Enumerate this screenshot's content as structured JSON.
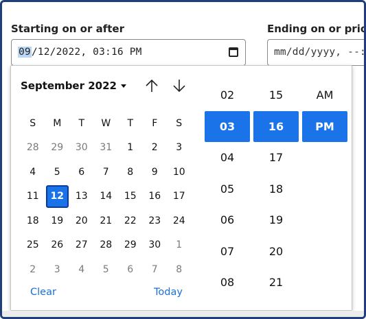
{
  "fields": {
    "start": {
      "label": "Starting on or after",
      "value_month": "09",
      "value_rest": "/12/2022, 03:16 PM"
    },
    "end": {
      "label": "Ending on or prio",
      "placeholder": "mm/dd/yyyy, --:"
    }
  },
  "calendar": {
    "month_label": "September 2022",
    "weekdays": [
      "S",
      "M",
      "T",
      "W",
      "T",
      "F",
      "S"
    ],
    "weeks": [
      [
        {
          "d": "28",
          "dim": true
        },
        {
          "d": "29",
          "dim": true
        },
        {
          "d": "30",
          "dim": true
        },
        {
          "d": "31",
          "dim": true
        },
        {
          "d": "1"
        },
        {
          "d": "2"
        },
        {
          "d": "3"
        }
      ],
      [
        {
          "d": "4"
        },
        {
          "d": "5"
        },
        {
          "d": "6"
        },
        {
          "d": "7"
        },
        {
          "d": "8"
        },
        {
          "d": "9"
        },
        {
          "d": "10"
        }
      ],
      [
        {
          "d": "11"
        },
        {
          "d": "12",
          "selected": true
        },
        {
          "d": "13"
        },
        {
          "d": "14"
        },
        {
          "d": "15"
        },
        {
          "d": "16"
        },
        {
          "d": "17"
        }
      ],
      [
        {
          "d": "18"
        },
        {
          "d": "19"
        },
        {
          "d": "20"
        },
        {
          "d": "21"
        },
        {
          "d": "22"
        },
        {
          "d": "23"
        },
        {
          "d": "24"
        }
      ],
      [
        {
          "d": "25"
        },
        {
          "d": "26"
        },
        {
          "d": "27"
        },
        {
          "d": "28"
        },
        {
          "d": "29"
        },
        {
          "d": "30"
        },
        {
          "d": "1",
          "dim": true
        }
      ],
      [
        {
          "d": "2",
          "dim": true
        },
        {
          "d": "3",
          "dim": true
        },
        {
          "d": "4",
          "dim": true
        },
        {
          "d": "5",
          "dim": true
        },
        {
          "d": "6",
          "dim": true
        },
        {
          "d": "7",
          "dim": true
        },
        {
          "d": "8",
          "dim": true
        }
      ]
    ],
    "clear_label": "Clear",
    "today_label": "Today"
  },
  "time": {
    "hours": [
      "02",
      "03",
      "04",
      "05",
      "06",
      "07",
      "08"
    ],
    "selected_hour": "03",
    "minutes": [
      "15",
      "16",
      "17",
      "18",
      "19",
      "20",
      "21"
    ],
    "selected_minute": "16",
    "ampm": [
      "AM",
      "PM"
    ],
    "selected_ampm": "PM"
  },
  "colors": {
    "accent": "#1a73e8",
    "selected_border": "#0b3b99",
    "link": "#1a6fd8",
    "frame": "#1f3f7a"
  },
  "icons": {
    "calendar": "calendar-icon",
    "prev": "arrow-up-icon",
    "next": "arrow-down-icon",
    "month_dropdown": "caret-down-icon"
  }
}
